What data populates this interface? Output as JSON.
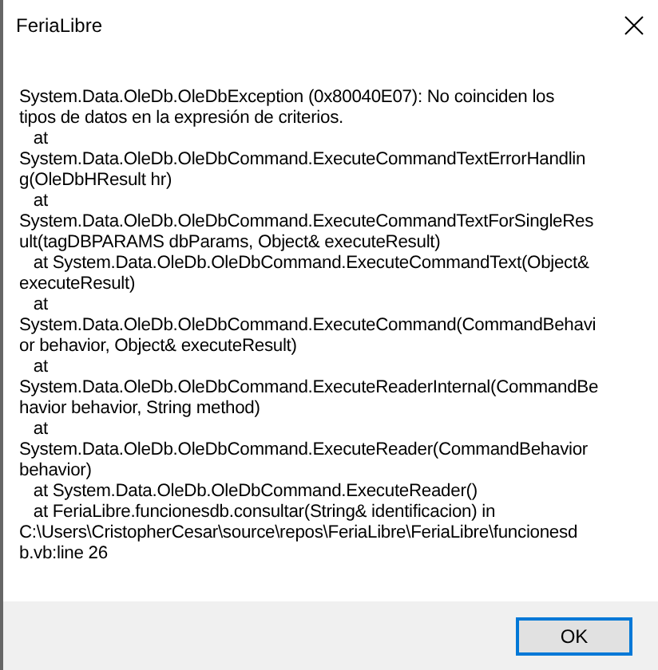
{
  "window": {
    "title": "FeriaLibre"
  },
  "message_lines": [
    "System.Data.OleDb.OleDbException (0x80040E07): No coinciden los",
    "tipos de datos en la expresión de criterios.",
    "   at",
    "System.Data.OleDb.OleDbCommand.ExecuteCommandTextErrorHandlin",
    "g(OleDbHResult hr)",
    "   at",
    "System.Data.OleDb.OleDbCommand.ExecuteCommandTextForSingleRes",
    "ult(tagDBPARAMS dbParams, Object& executeResult)",
    "   at System.Data.OleDb.OleDbCommand.ExecuteCommandText(Object&",
    "executeResult)",
    "   at",
    "System.Data.OleDb.OleDbCommand.ExecuteCommand(CommandBehavi",
    "or behavior, Object& executeResult)",
    "   at",
    "System.Data.OleDb.OleDbCommand.ExecuteReaderInternal(CommandBe",
    "havior behavior, String method)",
    "   at",
    "System.Data.OleDb.OleDbCommand.ExecuteReader(CommandBehavior",
    "behavior)",
    "   at System.Data.OleDb.OleDbCommand.ExecuteReader()",
    "   at FeriaLibre.funcionesdb.consultar(String& identificacion) in",
    "C:\\Users\\CristopherCesar\\source\\repos\\FeriaLibre\\FeriaLibre\\funcionesd",
    "b.vb:line 26"
  ],
  "buttons": [
    {
      "label": "OK",
      "selected": true
    }
  ]
}
